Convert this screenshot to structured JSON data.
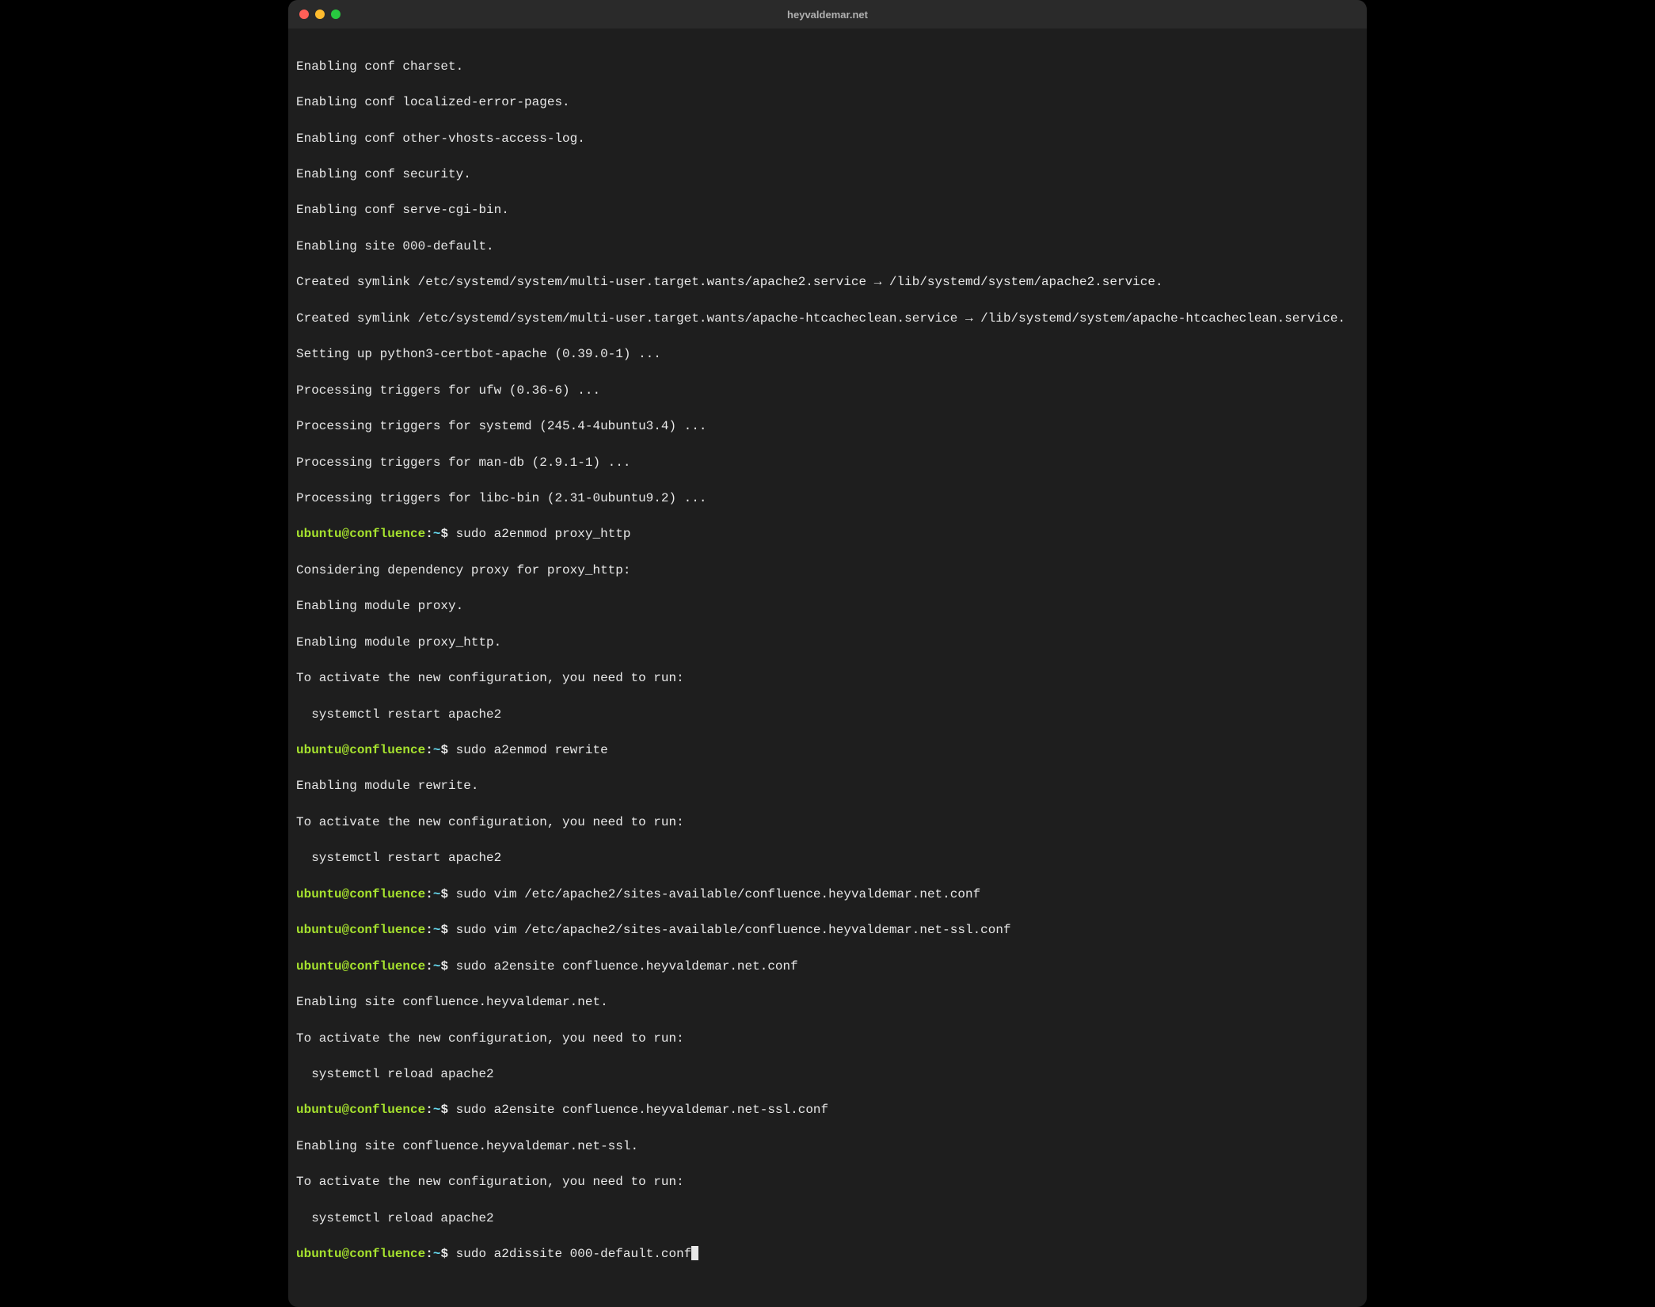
{
  "window": {
    "title": "heyvaldemar.net"
  },
  "colors": {
    "bg": "#1e1e1e",
    "titlebar": "#2a2a2a",
    "text": "#e8e8e8",
    "prompt_user": "#a6e22e",
    "prompt_path": "#66d9ef",
    "tl_close": "#ff5f57",
    "tl_min": "#febc2e",
    "tl_max": "#28c840"
  },
  "prompt": {
    "user_host": "ubuntu@confluence",
    "sep1": ":",
    "path": "~",
    "sigil": "$ "
  },
  "output": {
    "out01": "Enabling conf charset.",
    "out02": "Enabling conf localized-error-pages.",
    "out03": "Enabling conf other-vhosts-access-log.",
    "out04": "Enabling conf security.",
    "out05": "Enabling conf serve-cgi-bin.",
    "out06": "Enabling site 000-default.",
    "out07": "Created symlink /etc/systemd/system/multi-user.target.wants/apache2.service → /lib/systemd/system/apache2.service.",
    "out08": "Created symlink /etc/systemd/system/multi-user.target.wants/apache-htcacheclean.service → /lib/systemd/system/apache-htcacheclean.service.",
    "out09": "Setting up python3-certbot-apache (0.39.0-1) ...",
    "out10": "Processing triggers for ufw (0.36-6) ...",
    "out11": "Processing triggers for systemd (245.4-4ubuntu3.4) ...",
    "out12": "Processing triggers for man-db (2.9.1-1) ...",
    "out13": "Processing triggers for libc-bin (2.31-0ubuntu9.2) ...",
    "out14": "Considering dependency proxy for proxy_http:",
    "out15": "Enabling module proxy.",
    "out16": "Enabling module proxy_http.",
    "out17": "To activate the new configuration, you need to run:",
    "out18": "  systemctl restart apache2",
    "out19": "Enabling module rewrite.",
    "out20": "To activate the new configuration, you need to run:",
    "out21": "  systemctl restart apache2",
    "out22": "Enabling site confluence.heyvaldemar.net.",
    "out23": "To activate the new configuration, you need to run:",
    "out24": "  systemctl reload apache2",
    "out25": "Enabling site confluence.heyvaldemar.net-ssl.",
    "out26": "To activate the new configuration, you need to run:",
    "out27": "  systemctl reload apache2"
  },
  "cmds": {
    "cmd1": "sudo a2enmod proxy_http",
    "cmd2": "sudo a2enmod rewrite",
    "cmd3": "sudo vim /etc/apache2/sites-available/confluence.heyvaldemar.net.conf",
    "cmd4": "sudo vim /etc/apache2/sites-available/confluence.heyvaldemar.net-ssl.conf",
    "cmd5": "sudo a2ensite confluence.heyvaldemar.net.conf",
    "cmd6": "sudo a2ensite confluence.heyvaldemar.net-ssl.conf",
    "cmd7": "sudo a2dissite 000-default.conf"
  }
}
